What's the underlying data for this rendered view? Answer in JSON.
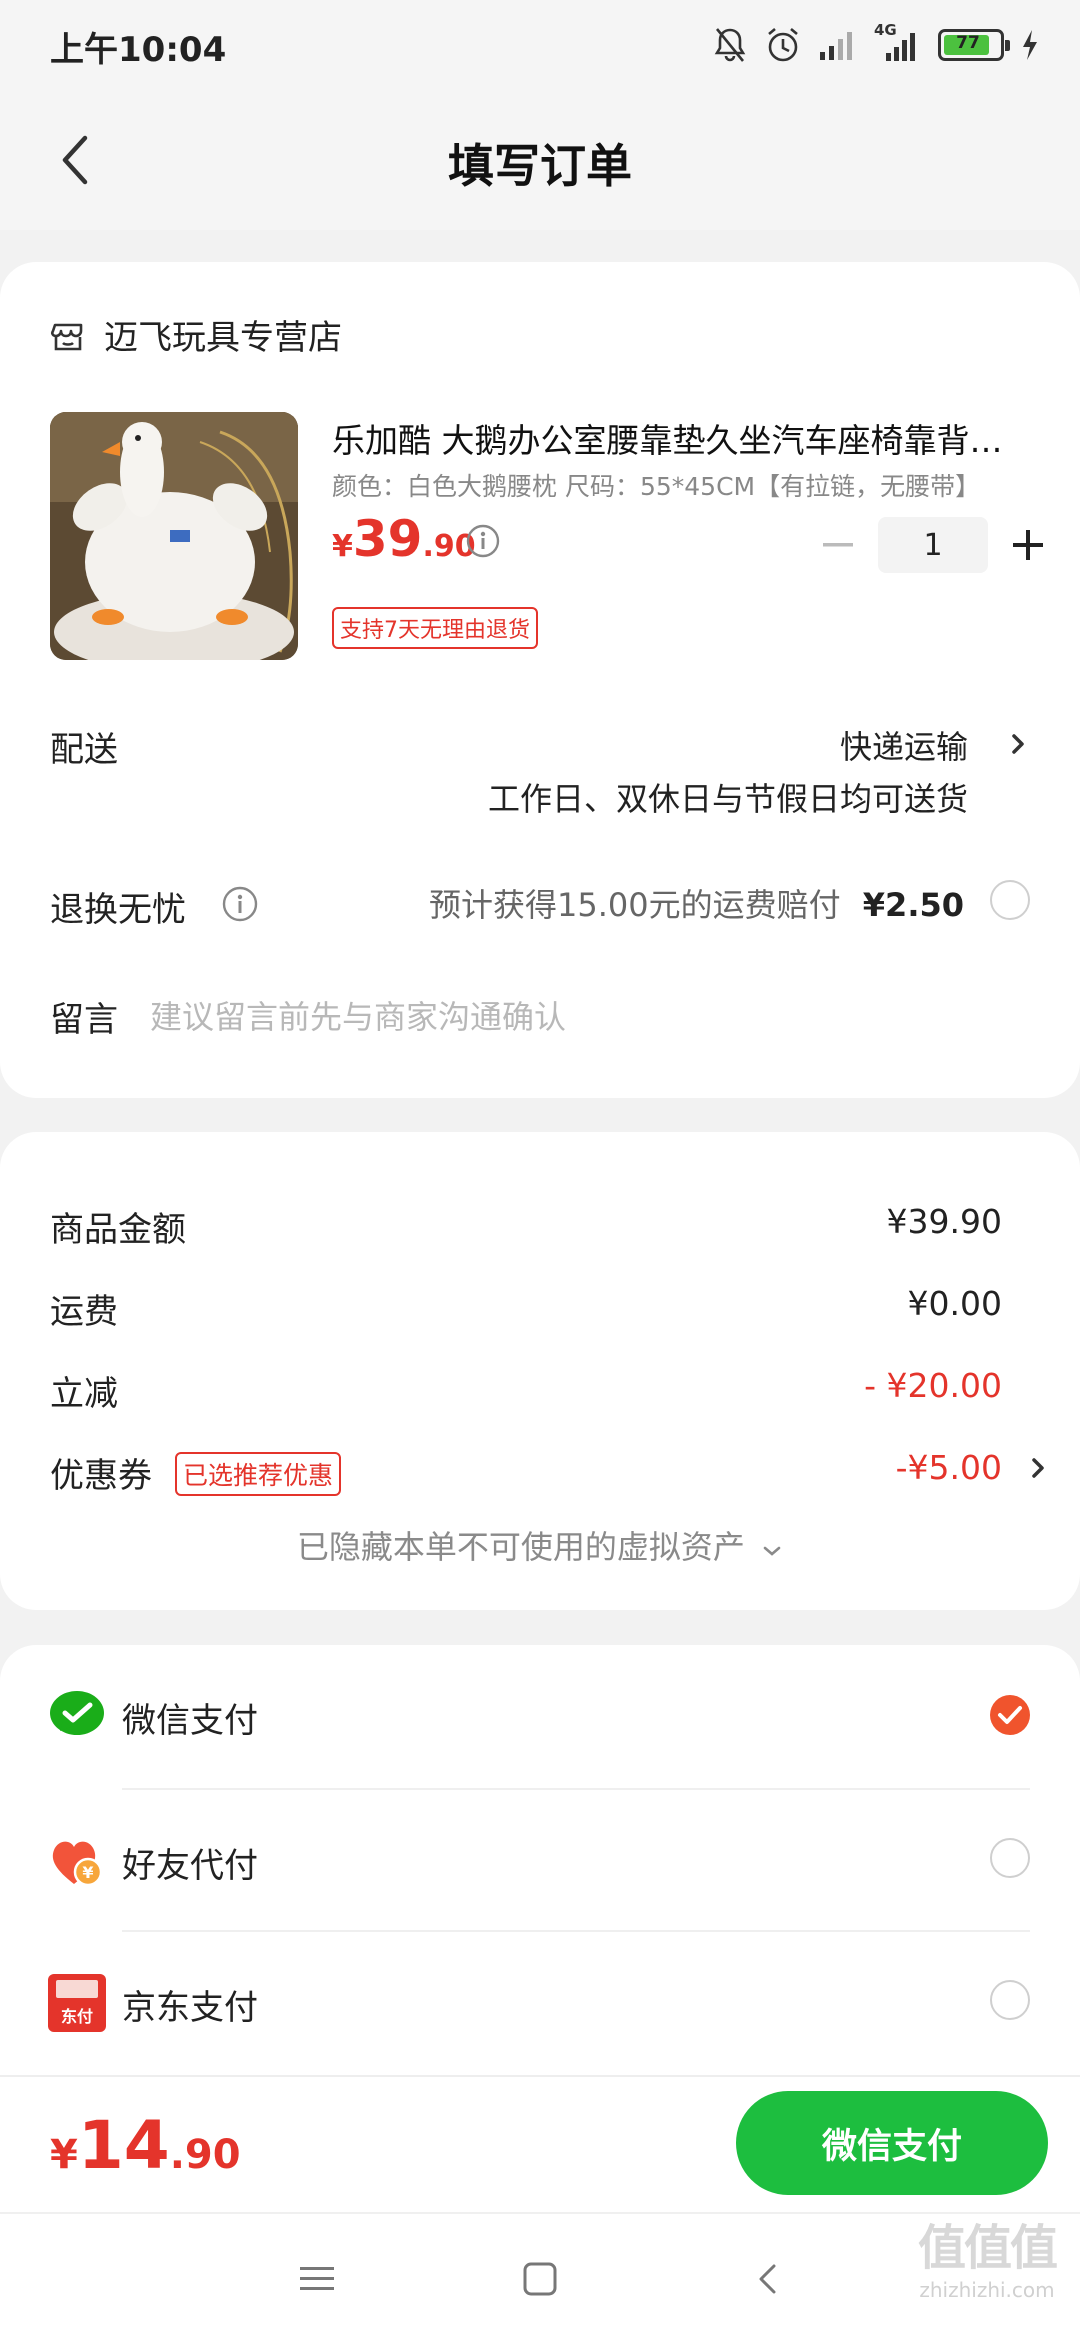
{
  "status_bar": {
    "time": "上午10:04",
    "network": "4G",
    "battery": "77",
    "icons": [
      "mute-bell-icon",
      "alarm-icon",
      "signal-icon",
      "signal-4g-icon",
      "battery-icon",
      "charging-icon"
    ]
  },
  "nav": {
    "title": "填写订单",
    "back_icon": "back-chevron-icon"
  },
  "shop": {
    "icon": "store-icon",
    "name": "迈飞玩具专营店"
  },
  "product": {
    "title": "乐加酷 大鹅办公室腰靠垫久坐汽车座椅靠背枕床头靠枕护腰枕",
    "spec": "颜色：白色大鹅腰枕    尺码：55*45CM【有拉链，无腰带】",
    "price": {
      "currency": "¥",
      "integer": "39",
      "decimal": ".90"
    },
    "quantity": "1",
    "return_badge": "支持7天无理由退货"
  },
  "delivery": {
    "label": "配送",
    "method": "快递运输",
    "note": "工作日、双休日与节假日均可送货"
  },
  "return_insurance": {
    "label": "退换无忧",
    "description": "预计获得15.00元的运费赔付",
    "price": "¥2.50",
    "selected": false
  },
  "message": {
    "label": "留言",
    "placeholder": "建议留言前先与商家沟通确认"
  },
  "summary": {
    "goods_label": "商品金额",
    "goods_value": "¥39.90",
    "shipping_label": "运费",
    "shipping_value": "¥0.00",
    "discount_label": "立减",
    "discount_value": "- ¥20.00",
    "coupon_label": "优惠券",
    "coupon_badge": "已选推荐优惠",
    "coupon_value": "-¥5.00",
    "hidden_assets": "已隐藏本单不可使用的虚拟资产"
  },
  "payment_methods": [
    {
      "label": "微信支付",
      "icon": "wechat-pay-icon",
      "selected": true
    },
    {
      "label": "好友代付",
      "icon": "friend-pay-icon",
      "selected": false
    },
    {
      "label": "京东支付",
      "icon": "jd-pay-icon",
      "selected": false,
      "icon_text": "东付"
    }
  ],
  "bottom": {
    "total": {
      "currency": "¥",
      "integer": "14",
      "decimal": ".90"
    },
    "pay_button": "微信支付"
  },
  "watermark": {
    "big": "值值值",
    "small": "zhizhizhi.com"
  },
  "colors": {
    "price_red": "#e4342b",
    "pay_green": "#1dbe3f",
    "check_orange": "#f0542d",
    "background": "#f2f2f2"
  }
}
